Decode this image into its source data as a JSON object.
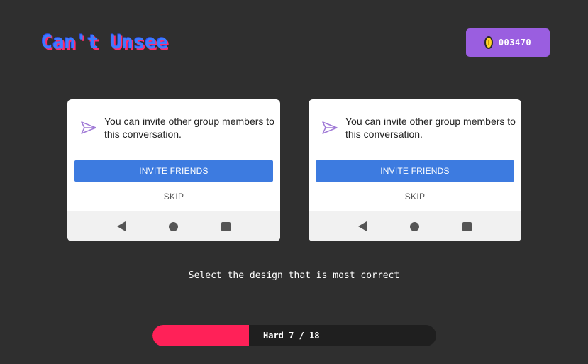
{
  "header": {
    "logo_text": "Can't Unsee",
    "coins": "003470",
    "coin_icon": "coin-icon"
  },
  "cards": [
    {
      "message": "You can invite other group members to this conversation.",
      "primary_label": "INVITE FRIENDS",
      "secondary_label": "SKIP",
      "icon": "send-icon",
      "accent": "#3d7be0"
    },
    {
      "message": "You can invite other group members to this conversation.",
      "primary_label": "INVITE FRIENDS",
      "secondary_label": "SKIP",
      "icon": "send-icon",
      "accent": "#3d7be0"
    }
  ],
  "nav_icons": [
    "back-icon",
    "home-icon",
    "recent-apps-icon"
  ],
  "prompt": "Select the design that is most correct",
  "progress": {
    "label": "Hard 7 / 18",
    "fraction": 0.34,
    "fill_color": "#ff2158"
  },
  "colors": {
    "background": "#2f2f2f",
    "coin_box": "#9a5ee0"
  }
}
